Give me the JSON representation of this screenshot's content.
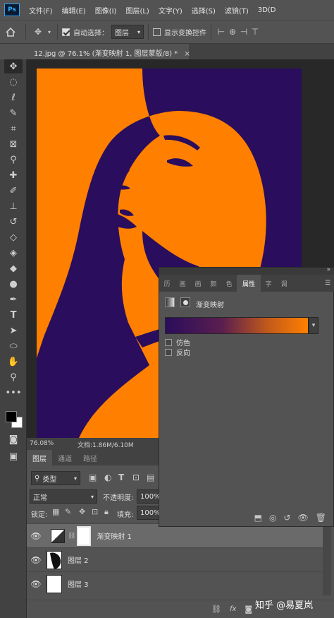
{
  "app": {
    "logo": "Ps"
  },
  "menu": [
    "文件(F)",
    "编辑(E)",
    "图像(I)",
    "图层(L)",
    "文字(Y)",
    "选择(S)",
    "滤镜(T)",
    "3D(D"
  ],
  "options": {
    "auto_select_label": "自动选择：",
    "auto_select_checked": true,
    "auto_select_value": "图层",
    "show_transform_label": "显示变换控件",
    "show_transform_checked": false
  },
  "document": {
    "tab_title": "12.jpg @ 76.1% (渐变映射 1, 图层蒙版/8) *",
    "zoom": "76.08%",
    "doc_size": "文档:1.86M/6.10M",
    "canvas_color": "#ff8000",
    "art_color": "#2a0d5c"
  },
  "toolbar": {
    "tools": [
      "move-tool",
      "marquee-tool",
      "lasso-tool",
      "quick-select-tool",
      "crop-tool",
      "frame-tool",
      "eyedropper-tool",
      "healing-tool",
      "brush-tool",
      "clone-stamp-tool",
      "history-brush-tool",
      "eraser-tool",
      "gradient-tool",
      "blur-tool",
      "dodge-tool",
      "pen-tool",
      "type-tool",
      "path-select-tool",
      "shape-tool",
      "hand-tool",
      "zoom-tool",
      "more-tool"
    ],
    "foreground_color": "#000000",
    "background_color": "#ffffff"
  },
  "properties_panel": {
    "tabs": [
      "历",
      "画",
      "画",
      "颜",
      "色",
      "属性",
      "字",
      "调"
    ],
    "active_tab": "属性",
    "adjustment_title": "渐变映射",
    "gradient_start": "#2a0d5c",
    "gradient_end": "#ff8000",
    "dither_label": "仿色",
    "dither_checked": false,
    "reverse_label": "反向",
    "reverse_checked": false
  },
  "layers_panel": {
    "tabs": [
      "图层",
      "通道",
      "路径"
    ],
    "active_tab": "图层",
    "filter_kind": "类型",
    "blend_mode": "正常",
    "opacity_label": "不透明度:",
    "opacity_value": "100%",
    "lock_label": "锁定:",
    "fill_label": "填充:",
    "fill_value": "100%",
    "layers": [
      {
        "name": "渐变映射 1",
        "selected": true,
        "visible": true
      },
      {
        "name": "图层 2",
        "selected": false,
        "visible": true
      },
      {
        "name": "图层 3",
        "selected": false,
        "visible": true
      }
    ],
    "footer_fx": "fx"
  },
  "watermark": "知乎 @易夏岚"
}
